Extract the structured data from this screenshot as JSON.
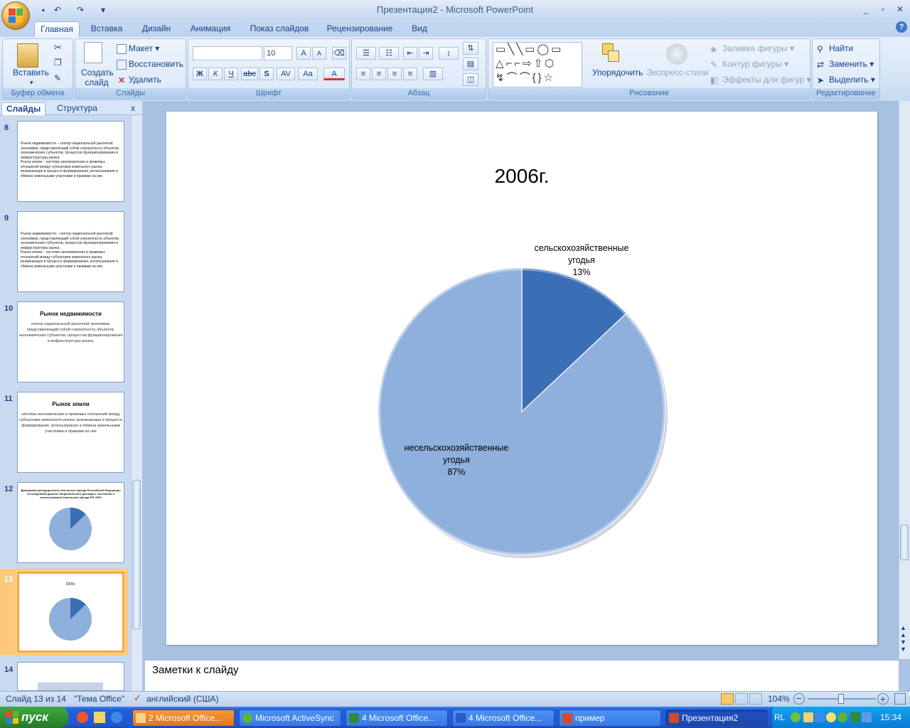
{
  "window": {
    "title": "Презентация2 - Microsoft PowerPoint",
    "minimize": "_",
    "restore": "▫",
    "close": "✕"
  },
  "qat": {
    "save": "save-icon",
    "undo": "undo-icon",
    "redo": "redo-icon",
    "more": "▾"
  },
  "ribbon_tabs": [
    "Главная",
    "Вставка",
    "Дизайн",
    "Анимация",
    "Показ слайдов",
    "Рецензирование",
    "Вид"
  ],
  "ribbon": {
    "clipboard": {
      "label": "Буфер обмена",
      "paste": "Вставить"
    },
    "slides": {
      "label": "Слайды",
      "new_slide": "Создать слайд",
      "layout": "Макет",
      "reset": "Восстановить",
      "delete": "Удалить"
    },
    "font": {
      "label": "Шрифт",
      "font_name": "",
      "font_size": "10",
      "bold": "Ж",
      "italic": "К",
      "underline": "Ч",
      "strike": "abc",
      "shadow": "S",
      "spacing": "AV",
      "case": "Aa",
      "color": "A",
      "grow": "A",
      "shrink": "A"
    },
    "paragraph": {
      "label": "Абзац"
    },
    "drawing": {
      "label": "Рисование",
      "arrange": "Упорядочить",
      "quick_styles": "Экспресс-стили",
      "fill": "Заливка фигуры",
      "outline": "Контур фигуры",
      "effects": "Эффекты для фигур"
    },
    "editing": {
      "label": "Редактирование",
      "find": "Найти",
      "replace": "Заменить",
      "select": "Выделить"
    }
  },
  "pane_tabs": {
    "slides": "Слайды",
    "outline": "Структура",
    "close": "x"
  },
  "thumbnails": [
    {
      "num": "8",
      "lines": [
        "Рынок недвижимости – сектор национальной рыночной экономики, представляющий собой совокупность объектов, экономических субъектов, процессов функционирования и инфраструктуры рынка.",
        "Рынок земли – система экономических и правовых отношений между субъектами земельного рынка, возникающих в процессе формирования, использования и обмена земельными участками и правами на них."
      ]
    },
    {
      "num": "9",
      "lines": [
        "Рынок недвижимости – сектор национальной рыночной экономики, представляющий собой совокупность объектов, экономических субъектов, процессов функционирования и инфраструктуры рынка.",
        "Рынок земли – система экономических и правовых отношений между субъектами земельного рынка, возникающих в процессе формирования, использования и обмена земельными участками и правами на них."
      ]
    },
    {
      "num": "10",
      "title": "Рынок недвижимости",
      "body": "сектор национальной рыночной экономики, представляющий собой совокупность объектов, экономических субъектов, процессов функционирования и инфраструктуры рынка."
    },
    {
      "num": "11",
      "title": "Рынок земли",
      "body": "система экономических и правовых отношений между субъектами земельного рынка, возникающих в процессе формирования, использования и обмена земельными участками и правами на них"
    },
    {
      "num": "12",
      "title": "Диаграмма распределения земельного фонда Российской Федерации по сведениям данных Национального доклада о состоянии и использовании земельного фонда РФ 2006"
    },
    {
      "num": "13",
      "title": "2006г."
    },
    {
      "num": "14"
    }
  ],
  "slide": {
    "title": "2006г."
  },
  "chart_data": {
    "type": "pie",
    "title": "2006г.",
    "categories": [
      "сельскохозяйственные угодья",
      "несельскохозяйственные угодья"
    ],
    "values": [
      13,
      87
    ],
    "labels": [
      "13%",
      "87%"
    ],
    "colors": [
      "#3a6fb6",
      "#8fb0dc"
    ],
    "legend": "none"
  },
  "notes": {
    "placeholder": "Заметки к слайду"
  },
  "status": {
    "slide": "Слайд 13 из 14",
    "theme": "\"Тема Office\"",
    "language": "английский (США)",
    "zoom": "104%"
  },
  "taskbar": {
    "start": "пуск",
    "tasks": [
      "2 Microsoft Office...",
      "Microsoft ActiveSync",
      "4 Microsoft Office...",
      "4 Microsoft Office...",
      "пример",
      "Презентация2"
    ],
    "lang": "RL",
    "clock": "15:34"
  }
}
